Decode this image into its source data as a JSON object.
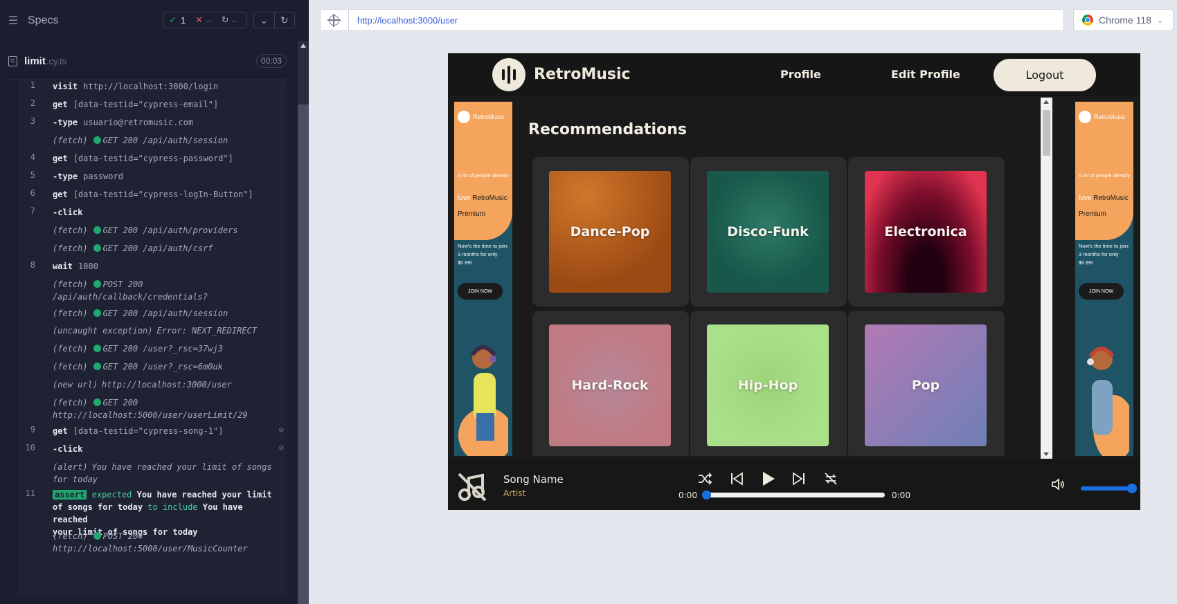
{
  "runner": {
    "specs_label": "Specs",
    "stats": {
      "passed": "1",
      "failed": "--",
      "pending": "--"
    },
    "spec": {
      "name": "limit",
      "ext": ".cy.ts",
      "duration": "00:03"
    }
  },
  "commands": [
    {
      "num": "1",
      "name": "visit",
      "msg": "http://localhost:3000/login"
    },
    {
      "num": "2",
      "name": "get",
      "msg": "[data-testid=\"cypress-email\"]"
    },
    {
      "num": "3",
      "name": "-type",
      "msg": "usuario@retromusic.com"
    },
    {
      "num": "",
      "event": "(fetch)",
      "dot": true,
      "msg": "GET 200 /api/auth/session"
    },
    {
      "num": "4",
      "name": "get",
      "msg": "[data-testid=\"cypress-password\"]"
    },
    {
      "num": "5",
      "name": "-type",
      "msg": "password"
    },
    {
      "num": "6",
      "name": "get",
      "msg": "[data-testid=\"cypress-logIn-Button\"]"
    },
    {
      "num": "7",
      "name": "-click",
      "msg": ""
    },
    {
      "num": "",
      "event": "(fetch)",
      "dot": true,
      "msg": "GET 200 /api/auth/providers"
    },
    {
      "num": "",
      "event": "(fetch)",
      "dot": true,
      "msg": "GET 200 /api/auth/csrf"
    },
    {
      "num": "8",
      "name": "wait",
      "msg": "1000"
    },
    {
      "num": "",
      "event": "(fetch)",
      "dot": true,
      "msg": "POST 200",
      "msg2": "/api/auth/callback/credentials?"
    },
    {
      "num": "",
      "event": "(fetch)",
      "dot": true,
      "msg": "GET 200 /api/auth/session"
    },
    {
      "num": "",
      "event": "(uncaught exception)",
      "dot": false,
      "msg": "Error: NEXT_REDIRECT"
    },
    {
      "num": "",
      "event": "(fetch)",
      "dot": true,
      "msg": "GET 200 /user?_rsc=37wj3"
    },
    {
      "num": "",
      "event": "(fetch)",
      "dot": true,
      "msg": "GET 200 /user?_rsc=6m0uk"
    },
    {
      "num": "",
      "event": "(new url)",
      "dot": false,
      "msg": "http://localhost:3000/user"
    },
    {
      "num": "",
      "event": "(fetch)",
      "dot": true,
      "msg": "GET 200",
      "msg2": "http://localhost:5000/user/userLimit/29"
    },
    {
      "num": "9",
      "name": "get",
      "msg": "[data-testid=\"cypress-song-1\"]",
      "eye": true
    },
    {
      "num": "10",
      "name": "-click",
      "msg": "",
      "eye": true
    },
    {
      "num": "",
      "event": "(alert)",
      "dot": false,
      "msg": "You have reached your limit of songs",
      "msg2": "for today"
    },
    {
      "num": "11",
      "assert": true,
      "badge": "assert",
      "w1": "expected",
      "s1": "You have reached your limit",
      "s1b": "of songs for today",
      "w2": "to include",
      "s2": "You have reached",
      "s2b": "your limit of songs for today"
    },
    {
      "num": "",
      "event": "(fetch)",
      "dot": true,
      "msg": "POST 204",
      "msg2": "http://localhost:5000/user/MusicCounter"
    }
  ],
  "browser": {
    "url": "http://localhost:3000/user",
    "name": "Chrome 118"
  },
  "app": {
    "brand": "RetroMusic",
    "nav": {
      "profile": "Profile",
      "edit_profile": "Edit Profile",
      "logout": "Logout"
    },
    "section_title": "Recommendations",
    "genres": [
      "Dance-Pop",
      "Disco-Funk",
      "Electronica",
      "Hard-Rock",
      "Hip-Hop",
      "Pop"
    ],
    "ad": {
      "brand": "RetroMusic",
      "line1": "A lot of people already",
      "love": "love",
      "brand2": "RetroMusic",
      "premium": "Premium",
      "promo1": "Now's the time to join:",
      "promo2": "3 months for only $0.99!",
      "join": "JOIN NOW"
    },
    "player": {
      "song_name": "Song Name",
      "artist": "Artist",
      "time_start": "0:00",
      "time_end": "0:00",
      "progress": 0,
      "volume": 1.0
    }
  }
}
